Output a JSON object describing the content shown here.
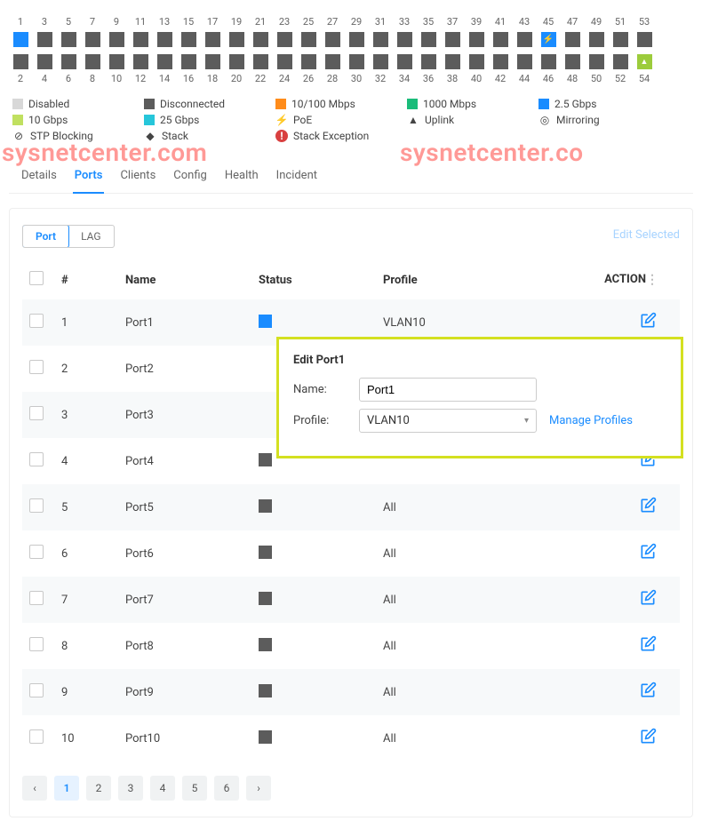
{
  "port_grid": {
    "top_nums": [
      1,
      3,
      5,
      7,
      9,
      11,
      13,
      15,
      17,
      19,
      21,
      23,
      25,
      27,
      29,
      31,
      33,
      35,
      37,
      39,
      41,
      43,
      45,
      47,
      49,
      51,
      53
    ],
    "bottom_nums": [
      2,
      4,
      6,
      8,
      10,
      12,
      14,
      16,
      18,
      20,
      22,
      24,
      26,
      28,
      30,
      32,
      34,
      36,
      38,
      40,
      42,
      44,
      46,
      48,
      50,
      52,
      54
    ],
    "top_special": {
      "0": "blue",
      "22": "bolt"
    },
    "bottom_special": {
      "26": "green-up"
    }
  },
  "legend": [
    {
      "swatch": "disabled",
      "label": "Disabled"
    },
    {
      "swatch": "disconnected",
      "label": "Disconnected"
    },
    {
      "swatch": "orange",
      "label": "10/100 Mbps"
    },
    {
      "swatch": "green",
      "label": "1000 Mbps"
    },
    {
      "swatch": "blue",
      "label": "2.5 Gbps"
    },
    {
      "swatch": "lime",
      "label": "10 Gbps"
    },
    {
      "swatch": "cyan",
      "label": "25 Gbps"
    },
    {
      "icon": "⚡",
      "label": "PoE"
    },
    {
      "icon": "▲",
      "label": "Uplink"
    },
    {
      "icon": "◎",
      "label": "Mirroring"
    },
    {
      "icon": "⊘",
      "label": "STP Blocking"
    },
    {
      "icon": "◆",
      "label": "Stack"
    },
    {
      "icon": "!",
      "iconColor": "#d94040",
      "label": "Stack Exception"
    }
  ],
  "watermark_left": "sysnetcenter.com",
  "watermark_right": "sysnetcenter.co",
  "tabs": [
    "Details",
    "Ports",
    "Clients",
    "Config",
    "Health",
    "Incident"
  ],
  "active_tab": 1,
  "subtabs": {
    "port": "Port",
    "lag": "LAG",
    "active": "port"
  },
  "edit_selected": "Edit Selected",
  "table": {
    "headers": {
      "num": "#",
      "name": "Name",
      "status": "Status",
      "profile": "Profile",
      "action": "ACTION"
    },
    "rows": [
      {
        "num": "1",
        "name": "Port1",
        "status": "blue",
        "profile": "VLAN10"
      },
      {
        "num": "2",
        "name": "Port2",
        "status": "",
        "profile": ""
      },
      {
        "num": "3",
        "name": "Port3",
        "status": "",
        "profile": ""
      },
      {
        "num": "4",
        "name": "Port4",
        "status": "gray",
        "profile": ""
      },
      {
        "num": "5",
        "name": "Port5",
        "status": "gray",
        "profile": "All"
      },
      {
        "num": "6",
        "name": "Port6",
        "status": "gray",
        "profile": "All"
      },
      {
        "num": "7",
        "name": "Port7",
        "status": "gray",
        "profile": "All"
      },
      {
        "num": "8",
        "name": "Port8",
        "status": "gray",
        "profile": "All"
      },
      {
        "num": "9",
        "name": "Port9",
        "status": "gray",
        "profile": "All"
      },
      {
        "num": "10",
        "name": "Port10",
        "status": "gray",
        "profile": "All"
      }
    ]
  },
  "edit_panel": {
    "title": "Edit Port1",
    "name_label": "Name:",
    "name_value": "Port1",
    "profile_label": "Profile:",
    "profile_value": "VLAN10",
    "manage_link": "Manage Profiles"
  },
  "pager": {
    "pages": [
      "1",
      "2",
      "3",
      "4",
      "5",
      "6"
    ],
    "active": 0
  }
}
